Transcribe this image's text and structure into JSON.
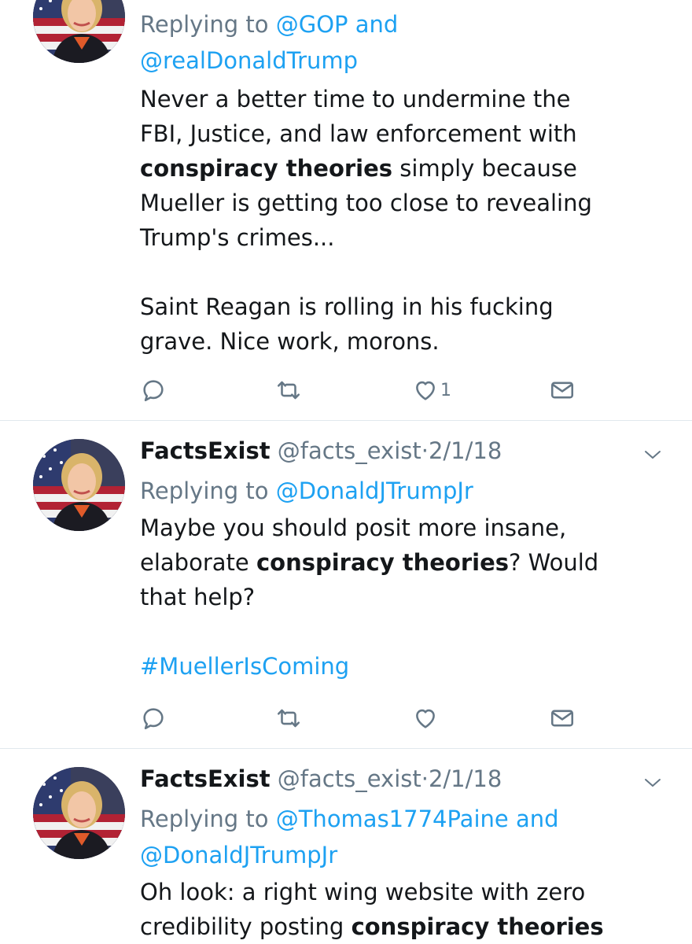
{
  "tweets": [
    {
      "name": "",
      "handle": "",
      "date": "",
      "replying_prefix": "Replying to",
      "mentions_line1": "@GOP and",
      "mentions_line2": "@realDonaldTrump",
      "body_lines": [
        "Never a better time to undermine the",
        "FBI, Justice, and law enforcement with",
        "simply because",
        "Mueller is getting too close to revealing",
        "Trump's crimes...",
        "Saint Reagan is rolling in his fucking",
        "grave. Nice work, morons."
      ],
      "keyword": "conspiracy theories",
      "like_count": "1"
    },
    {
      "name": "FactsExist",
      "handle": "@facts_exist",
      "date": "2/1/18",
      "replying_prefix": "Replying to",
      "mentions_line1": "@DonaldJTrumpJr",
      "body_lines": [
        "Maybe you should posit more insane,",
        "elaborate",
        "? Would",
        "that help?"
      ],
      "keyword": "conspiracy theories",
      "hashtag": "#MuellerIsComing"
    },
    {
      "name": "FactsExist",
      "handle": "@facts_exist",
      "date": "2/1/18",
      "replying_prefix": "Replying to",
      "mentions_line1": "@Thomas1774Paine and",
      "mentions_line2": "@DonaldJTrumpJr",
      "body_lines": [
        "Oh look: a right wing website with zero",
        "credibility posting"
      ],
      "keyword": "conspiracy theories"
    }
  ],
  "separator": "·",
  "icons": {
    "reply": "reply-icon",
    "retweet": "retweet-icon",
    "like": "heart-icon",
    "dm": "envelope-icon",
    "caret": "chevron-down-icon"
  },
  "colors": {
    "link": "#1da1f2",
    "muted": "#657786",
    "text": "#14171a",
    "divider": "#e1e8ed"
  }
}
